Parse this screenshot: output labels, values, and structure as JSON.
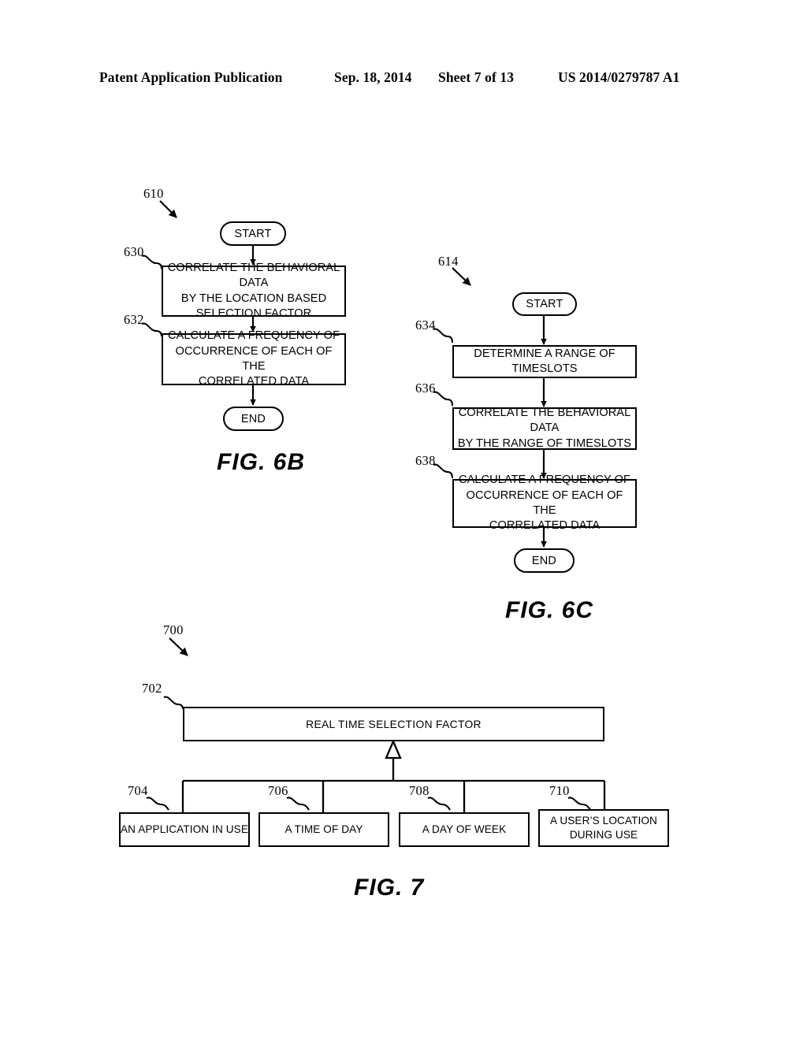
{
  "header": {
    "title": "Patent Application Publication",
    "date": "Sep. 18, 2014",
    "sheet": "Sheet 7 of 13",
    "publication_number": "US 2014/0279787 A1"
  },
  "figures": [
    {
      "caption": "FIG. 6B",
      "flow_ref": "610",
      "nodes": [
        {
          "ref": "",
          "type": "terminator",
          "text": "START"
        },
        {
          "ref": "630",
          "type": "process",
          "text": "CORRELATE THE BEHAVIORAL DATA BY THE LOCATION BASED SELECTION FACTOR"
        },
        {
          "ref": "632",
          "type": "process",
          "text": "CALCULATE A FREQUENCY OF OCCURRENCE OF EACH OF THE CORRELATED DATA"
        },
        {
          "ref": "",
          "type": "terminator",
          "text": "END"
        }
      ]
    },
    {
      "caption": "FIG. 6C",
      "flow_ref": "614",
      "nodes": [
        {
          "ref": "",
          "type": "terminator",
          "text": "START"
        },
        {
          "ref": "634",
          "type": "process",
          "text": "DETERMINE A RANGE OF TIMESLOTS"
        },
        {
          "ref": "636",
          "type": "process",
          "text": "CORRELATE THE BEHAVIORAL DATA BY THE RANGE OF TIMESLOTS"
        },
        {
          "ref": "638",
          "type": "process",
          "text": "CALCULATE A FREQUENCY OF OCCURRENCE OF EACH OF THE CORRELATED DATA"
        },
        {
          "ref": "",
          "type": "terminator",
          "text": "END"
        }
      ]
    },
    {
      "caption": "FIG. 7",
      "flow_ref": "700",
      "parent": {
        "ref": "702",
        "text": "REAL TIME SELECTION FACTOR"
      },
      "children": [
        {
          "ref": "704",
          "text": "AN APPLICATION IN USE"
        },
        {
          "ref": "706",
          "text": "A TIME OF DAY"
        },
        {
          "ref": "708",
          "text": "A DAY OF WEEK"
        },
        {
          "ref": "710",
          "text": "A USER’S LOCATION DURING USE"
        }
      ]
    }
  ],
  "fig6b": {
    "ref": "610",
    "start": "START",
    "step630_ref": "630",
    "step630": "CORRELATE THE BEHAVIORAL DATA BY THE LOCATION BASED SELECTION FACTOR",
    "step630_l1": "CORRELATE THE BEHAVIORAL DATA",
    "step630_l2": "BY THE LOCATION BASED",
    "step630_l3": "SELECTION FACTOR",
    "step632_ref": "632",
    "step632_l1": "CALCULATE A FREQUENCY OF",
    "step632_l2": "OCCURRENCE OF EACH OF THE",
    "step632_l3": "CORRELATED DATA",
    "end": "END",
    "caption": "FIG. 6B"
  },
  "fig6c": {
    "ref": "614",
    "start": "START",
    "step634_ref": "634",
    "step634_l1": "DETERMINE A RANGE OF TIMESLOTS",
    "step636_ref": "636",
    "step636_l1": "CORRELATE THE BEHAVIORAL DATA",
    "step636_l2": "BY THE RANGE OF TIMESLOTS",
    "step638_ref": "638",
    "step638_l1": "CALCULATE A FREQUENCY OF",
    "step638_l2": "OCCURRENCE OF EACH OF THE",
    "step638_l3": "CORRELATED DATA",
    "end": "END",
    "caption": "FIG. 6C"
  },
  "fig7": {
    "ref": "700",
    "parent_ref": "702",
    "parent_text": "REAL TIME SELECTION FACTOR",
    "child1_ref": "704",
    "child1_text": "AN APPLICATION IN USE",
    "child2_ref": "706",
    "child2_text": "A TIME OF DAY",
    "child3_ref": "708",
    "child3_text": "A DAY OF WEEK",
    "child4_ref": "710",
    "child4_l1": "A USER’S LOCATION",
    "child4_l2": "DURING USE",
    "caption": "FIG. 7"
  },
  "colors": {
    "ink": "#000000",
    "paper": "#ffffff"
  }
}
